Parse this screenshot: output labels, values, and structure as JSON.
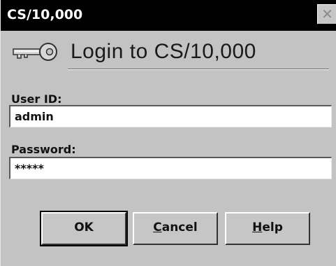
{
  "window": {
    "title": "CS/10,000",
    "close_glyph": "✕"
  },
  "header": {
    "icon": "key-icon",
    "heading": "Login to CS/10,000"
  },
  "form": {
    "user_id_label": "User ID:",
    "user_id_value": "admin",
    "password_label": "Password:",
    "password_value": "*****"
  },
  "buttons": {
    "ok": "OK",
    "cancel_first": "C",
    "cancel_rest": "ancel",
    "help_first": "H",
    "help_rest": "elp"
  },
  "colors": {
    "titlebar": "#000000",
    "dialog_face": "#c3c3c3",
    "field_bg": "#ffffff"
  }
}
